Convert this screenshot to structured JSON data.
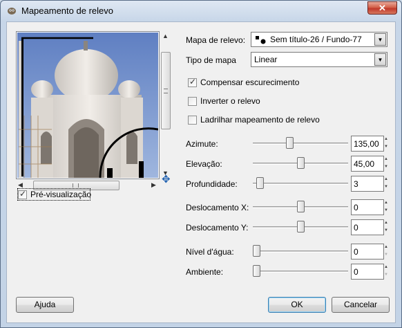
{
  "window": {
    "title": "Mapeamento de relevo",
    "close_glyph": "✕"
  },
  "preview": {
    "checkbox_label": "Pré-visualização",
    "checkbox_checked": true,
    "image_icon": "taj-mahal-preview-image"
  },
  "settings": {
    "bump_map": {
      "label": "Mapa de relevo:",
      "value": "Sem título-26 / Fundo-77",
      "icon": "image-thumbnail-icon"
    },
    "map_type": {
      "label": "Tipo de mapa",
      "value": "Linear"
    },
    "compensate": {
      "label": "Compensar escurecimento",
      "checked": true
    },
    "invert": {
      "label": "Inverter o relevo",
      "checked": false
    },
    "tile": {
      "label": "Ladrilhar mapeamento de relevo",
      "checked": false
    }
  },
  "sliders": {
    "azimuth": {
      "label": "Azimute:",
      "value": "135,00",
      "fraction": 0.375
    },
    "elevation": {
      "label": "Elevação:",
      "value": "45,00",
      "fraction": 0.5
    },
    "depth": {
      "label": "Profundidade:",
      "value": "3",
      "fraction": 0.04
    },
    "offset_x": {
      "label": "Deslocamento X:",
      "value": "0",
      "fraction": 0.5
    },
    "offset_y": {
      "label": "Deslocamento Y:",
      "value": "0",
      "fraction": 0.5
    },
    "water_level": {
      "label": "Nível d'água:",
      "value": "0",
      "fraction": 0.0
    },
    "ambient": {
      "label": "Ambiente:",
      "value": "0",
      "fraction": 0.0
    }
  },
  "buttons": {
    "help": "Ajuda",
    "ok": "OK",
    "cancel": "Cancelar"
  },
  "colors": {
    "title_bg": "#c7d6e8",
    "default_button_border": "#3c7fb1",
    "close_button": "#c0392b"
  }
}
